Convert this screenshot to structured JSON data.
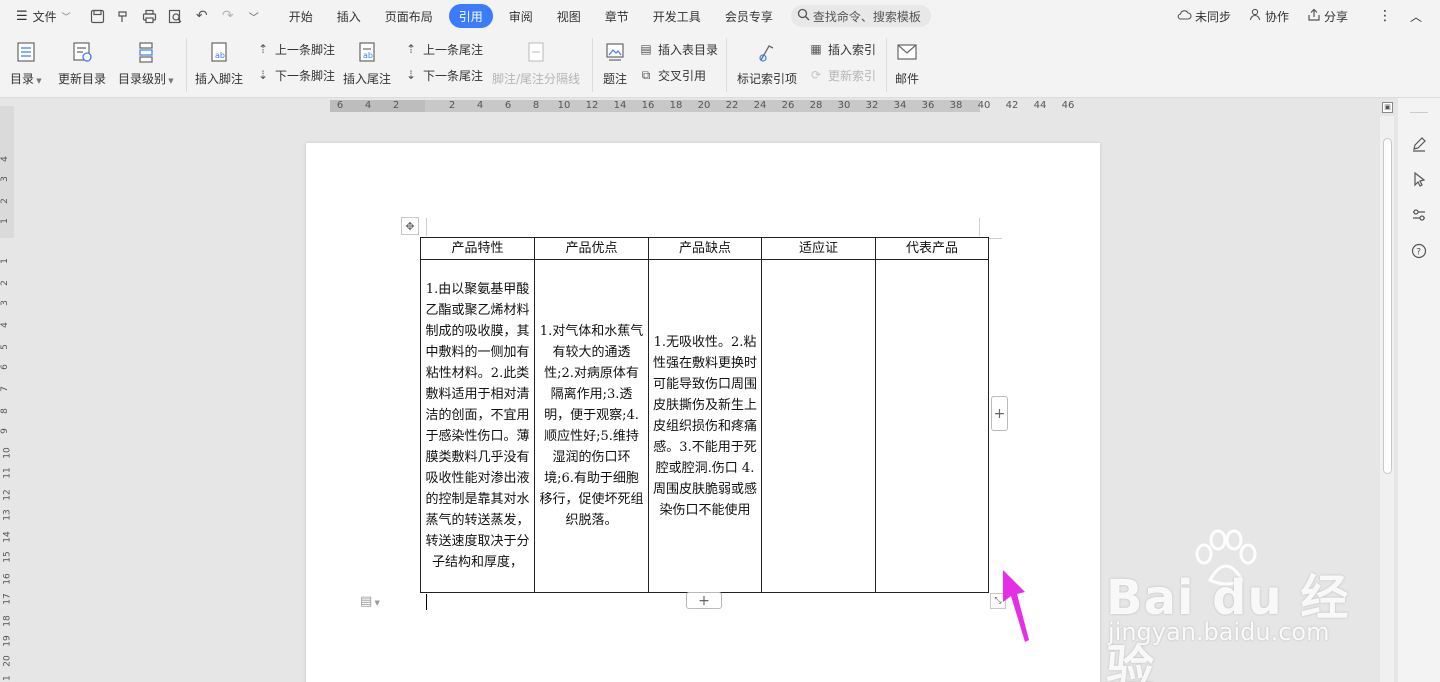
{
  "menubar": {
    "file_label": "文件",
    "tabs": [
      {
        "label": "开始",
        "active": false
      },
      {
        "label": "插入",
        "active": false
      },
      {
        "label": "页面布局",
        "active": false
      },
      {
        "label": "引用",
        "active": true
      },
      {
        "label": "审阅",
        "active": false
      },
      {
        "label": "视图",
        "active": false
      },
      {
        "label": "章节",
        "active": false
      },
      {
        "label": "开发工具",
        "active": false
      },
      {
        "label": "会员专享",
        "active": false
      }
    ],
    "search_placeholder": "查找命令、搜索模板",
    "sync_label": "未同步",
    "collab_label": "协作",
    "share_label": "分享",
    "accent_color": "#3b7cff"
  },
  "ribbon": {
    "toc": "目录",
    "update_toc": "更新目录",
    "toc_level": "目录级别",
    "insert_footnote": "插入脚注",
    "prev_footnote": "上一条脚注",
    "next_footnote": "下一条脚注",
    "insert_endnote": "插入尾注",
    "prev_endnote": "上一条尾注",
    "next_endnote": "下一条尾注",
    "note_separator": "脚注/尾注分隔线",
    "caption": "题注",
    "insert_table_of_figures": "插入表目录",
    "cross_reference": "交叉引用",
    "mark_index_entry": "标记索引项",
    "insert_index": "插入索引",
    "update_index": "更新索引",
    "mail": "邮件"
  },
  "ruler": {
    "h_numbers": [
      "6",
      "4",
      "2",
      "2",
      "2",
      "4",
      "6",
      "8",
      "10",
      "12",
      "14",
      "16",
      "18",
      "20",
      "22",
      "24",
      "26",
      "28",
      "30",
      "32",
      "34",
      "36",
      "38",
      "40",
      "42",
      "44",
      "46"
    ],
    "v_numbers": [
      "4",
      "3",
      "2",
      "1",
      "1",
      "2",
      "3",
      "4",
      "5",
      "6",
      "7",
      "8",
      "9",
      "10",
      "11",
      "12",
      "13",
      "14",
      "15",
      "16",
      "17",
      "18",
      "19",
      "20",
      "21"
    ]
  },
  "table": {
    "headers": [
      "产品特性",
      "产品优点",
      "产品缺点",
      "适应证",
      "代表产品"
    ],
    "row": [
      "1.由以聚氨基甲酸乙酯或聚乙烯材料制成的吸收膜，其中敷料的一侧加有粘性材料。2.此类敷料适用于相对清洁的创面，不宜用于感染性伤口。薄膜类敷料几乎没有吸收性能对渗出液的控制是靠其对水蒸气的转送蒸发，转送速度取决于分子结构和厚度，",
      "1.对气体和水蕉气有较大的通透性;2.对病原体有隔离作用;3.透明，便于观察;4.顺应性好;5.维持湿润的伤口环境;6.有助于细胞移行，促使坏死组织脱落。",
      "1.无吸收性。2.粘性强在敷料更换时可能导致伤口周围皮肤撕伤及新生上皮组织损伤和疼痛感。3.不能用于死腔或腔洞.伤口 4.周围皮肤脆弱或感染伤口不能使用",
      "",
      ""
    ]
  },
  "watermark": {
    "logo": "Bai du 经验",
    "url": "jingyan.baidu.com"
  }
}
